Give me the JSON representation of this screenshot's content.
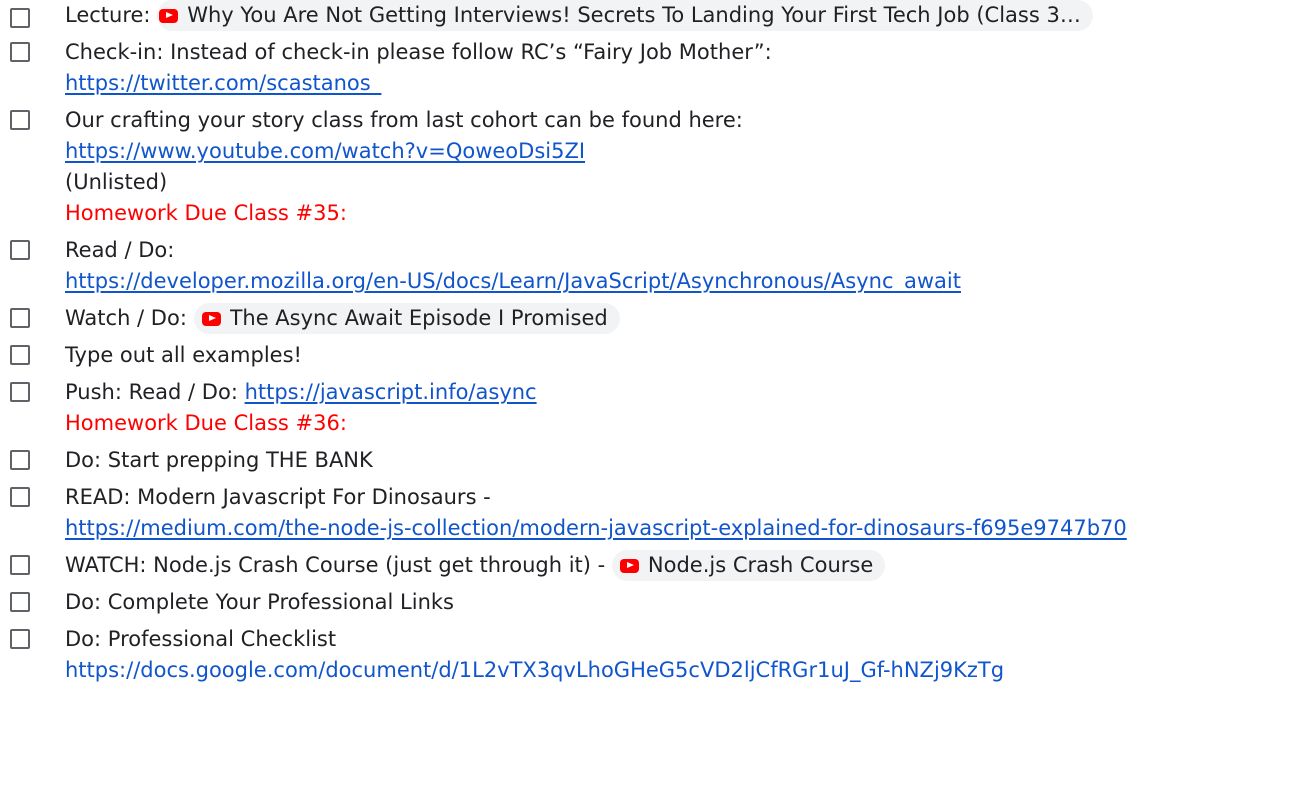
{
  "items": {
    "lecture": {
      "label": "Lecture: ",
      "chip": "Why You Are Not Getting Interviews! Secrets To Landing Your First Tech Job (Class 3…"
    },
    "checkin": {
      "text": "Check-in:  Instead of check-in please follow RC’s “Fairy Job Mother”:",
      "link": "https://twitter.com/scastanos_"
    },
    "crafting": {
      "text": "Our crafting your story class from last cohort can be found here:",
      "link": "https://www.youtube.com/watch?v=QoweoDsi5ZI",
      "note": "(Unlisted)"
    },
    "homework_35": "Homework Due Class #35:",
    "read_do": {
      "label": "Read / Do:",
      "link": "https://developer.mozilla.org/en-US/docs/Learn/JavaScript/Asynchronous/Async_await"
    },
    "watch_do": {
      "label": "Watch / Do: ",
      "chip": "The Async Await Episode I Promised"
    },
    "type_out": "Type out all examples!",
    "push": {
      "label": "Push: Read / Do: ",
      "link": "https://javascript.info/async"
    },
    "homework_36": "Homework Due Class #36:",
    "bank": "Do: Start prepping THE BANK",
    "dinosaurs": {
      "label": "READ: Modern Javascript For Dinosaurs -",
      "link": "https://medium.com/the-node-js-collection/modern-javascript-explained-for-dinosaurs-f695e9747b70"
    },
    "node": {
      "label": "WATCH: Node.js Crash Course (just get through it) - ",
      "chip": "Node.js Crash Course"
    },
    "links": "Do: Complete Your Professional Links",
    "checklist": {
      "label": "Do: Professional Checklist",
      "link": "https://docs.google.com/document/d/1L2vTX3qvLhoGHeG5cVD2ljCfRGr1uJ_Gf-hNZj9KzTg"
    }
  },
  "colors": {
    "link": "#1155cc",
    "homework": "#ff0000",
    "chip_bg": "#f1f3f4",
    "youtube": "#ff0000"
  },
  "icons": {
    "checkbox": "checkbox-icon",
    "youtube": "youtube-icon"
  }
}
